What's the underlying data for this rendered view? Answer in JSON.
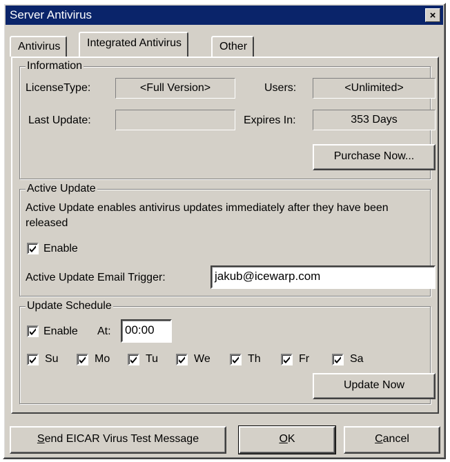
{
  "window": {
    "title": "Server Antivirus",
    "close_glyph": "×"
  },
  "tabs": [
    {
      "label": "Antivirus",
      "active": false
    },
    {
      "label": "Integrated Antivirus",
      "active": true
    },
    {
      "label": "Other",
      "active": false
    }
  ],
  "information": {
    "legend": "Information",
    "license_type_label": "LicenseType:",
    "license_type_value": "<Full Version>",
    "users_label": "Users:",
    "users_value": "<Unlimited>",
    "last_update_label": "Last Update:",
    "last_update_value": "",
    "expires_label": "Expires In:",
    "expires_value": "353 Days",
    "purchase_button": "Purchase Now..."
  },
  "active_update": {
    "legend": "Active Update",
    "description": "Active Update enables antivirus updates immediately after they have been released",
    "enable_label": "Enable",
    "enable_checked": true,
    "email_trigger_label": "Active Update Email Trigger:",
    "email_trigger_value": "jakub@icewarp.com"
  },
  "update_schedule": {
    "legend": "Update Schedule",
    "enable_label": "Enable",
    "enable_checked": true,
    "at_label": "At:",
    "at_value": "00:00",
    "days": [
      {
        "label": "Su",
        "checked": true
      },
      {
        "label": "Mo",
        "checked": true
      },
      {
        "label": "Tu",
        "checked": true
      },
      {
        "label": "We",
        "checked": true
      },
      {
        "label": "Th",
        "checked": true
      },
      {
        "label": "Fr",
        "checked": true
      },
      {
        "label": "Sa",
        "checked": true
      }
    ],
    "update_now_button": "Update Now"
  },
  "footer": {
    "eicar_prefix": "S",
    "eicar_rest": "end EICAR Virus Test Message",
    "ok_prefix": "O",
    "ok_rest": "K",
    "cancel_prefix": "C",
    "cancel_rest": "ancel"
  }
}
